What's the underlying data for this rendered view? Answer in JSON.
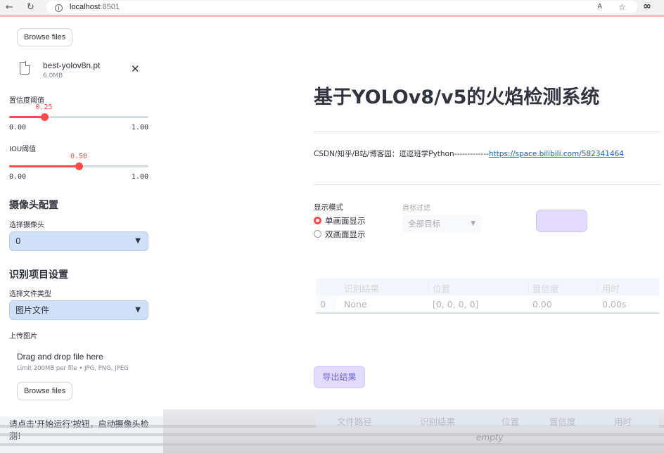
{
  "browser": {
    "back_icon": "←",
    "reload_icon": "↻",
    "url_host": "localhost",
    "url_port": ":8501",
    "read_aloud_icon": "A",
    "favorite_icon": "☆",
    "extension_icon": "∞"
  },
  "sidebar": {
    "browse_label_top": "Browse files",
    "model_file": {
      "name": "best-yolov8n.pt",
      "size": "6.0MB",
      "close": "✕"
    },
    "conf_slider": {
      "label": "置信度阈值",
      "value": 0.25,
      "value_text": "0.25",
      "min": "0.00",
      "max": "1.00"
    },
    "iou_slider": {
      "label": "IOU阈值",
      "value": 0.5,
      "value_text": "0.50",
      "min": "0.00",
      "max": "1.00"
    },
    "camera_header": "摄像头配置",
    "camera_label": "选择摄像头",
    "camera_value": "0",
    "project_header": "识别项目设置",
    "filetype_label": "选择文件类型",
    "filetype_value": "图片文件",
    "upload_label": "上传图片",
    "drop_title": "Drag and drop file here",
    "drop_limit": "Limit 200MB per file • JPG, PNG, JPEG",
    "browse_label_bottom": "Browse files",
    "status_text": "请点击'开始运行'按钮，启动摄像头检测!"
  },
  "main": {
    "title": "基于YOLOv8/v5的火焰检测系统",
    "credit_prefix": "CSDN/知乎/B站/博客园：逗逗班学Python-------------",
    "credit_link": "https://space.bilibili.com/582341464",
    "display_mode_label": "显示模式",
    "mode_single": "单画面显示",
    "mode_dual": "双画面显示",
    "target_filter_label": "目标过滤",
    "target_filter_value": "全部目标",
    "results_table": {
      "headers": [
        "识别结果",
        "位置",
        "置信度",
        "用时"
      ],
      "row": {
        "index": "0",
        "result": "None",
        "position": "[0, 0, 0, 0]",
        "confidence": "0.00",
        "time": "0.00s"
      }
    },
    "export_label": "导出结果",
    "files_table": {
      "headers": [
        "文件路径",
        "识别结果",
        "位置",
        "置信度",
        "用时"
      ],
      "empty_text": "empty"
    }
  },
  "colors": {
    "accent": "#ff4b4b",
    "select_bg": "#cfe0f8",
    "link": "#1a5fb4"
  }
}
